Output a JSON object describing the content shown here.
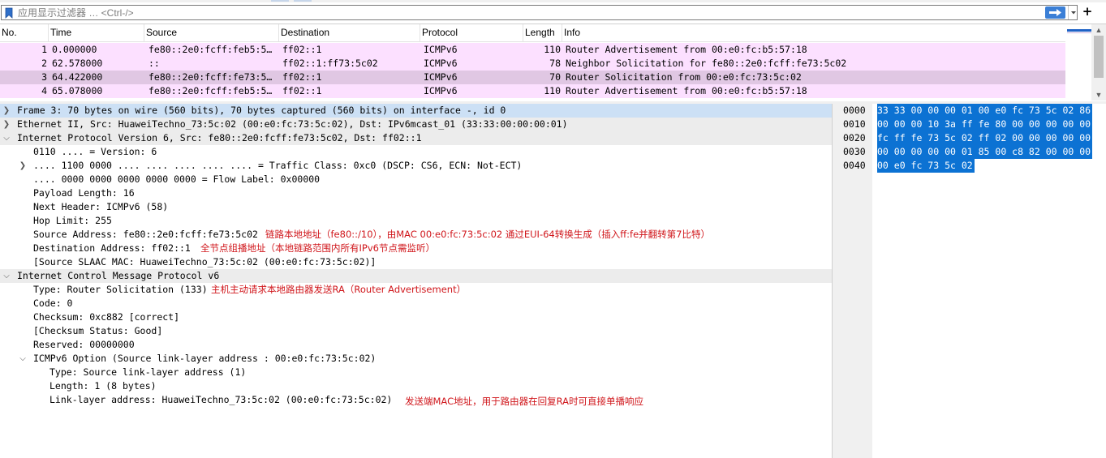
{
  "filter": {
    "placeholder": "应用显示过滤器 … <Ctrl-/>",
    "value": ""
  },
  "icons": {
    "bookmark": "bookmark-icon",
    "apply": "arrow-right-icon",
    "dropdown": "chevron-down-icon",
    "add": "plus-icon",
    "collapsed": "chevron-right-icon",
    "expanded": "chevron-down-icon"
  },
  "colors": {
    "icmp_row": "#fce0ff",
    "selected_row": "#e0c7e3",
    "annotation": "#d0161b",
    "byte_highlight": "#0c72d3"
  },
  "packet_list": {
    "columns": [
      "No.",
      "Time",
      "Source",
      "Destination",
      "Protocol",
      "Length",
      "Info"
    ],
    "rows": [
      {
        "no": "1",
        "time": "0.000000",
        "source": "fe80::2e0:fcff:feb5:5…",
        "destination": "ff02::1",
        "protocol": "ICMPv6",
        "length": "110",
        "info": "Router Advertisement from 00:e0:fc:b5:57:18",
        "selected": false
      },
      {
        "no": "2",
        "time": "62.578000",
        "source": "::",
        "destination": "ff02::1:ff73:5c02",
        "protocol": "ICMPv6",
        "length": "78",
        "info": "Neighbor Solicitation for fe80::2e0:fcff:fe73:5c02",
        "selected": false
      },
      {
        "no": "3",
        "time": "64.422000",
        "source": "fe80::2e0:fcff:fe73:5…",
        "destination": "ff02::1",
        "protocol": "ICMPv6",
        "length": "70",
        "info": "Router Solicitation from 00:e0:fc:73:5c:02",
        "selected": true
      },
      {
        "no": "4",
        "time": "65.078000",
        "source": "fe80::2e0:fcff:feb5:5…",
        "destination": "ff02::1",
        "protocol": "ICMPv6",
        "length": "110",
        "info": "Router Advertisement from 00:e0:fc:b5:57:18",
        "selected": false
      }
    ]
  },
  "details": {
    "frame": "Frame 3: 70 bytes on wire (560 bits), 70 bytes captured (560 bits) on interface -, id 0",
    "ethernet": "Ethernet II, Src: HuaweiTechno_73:5c:02 (00:e0:fc:73:5c:02), Dst: IPv6mcast_01 (33:33:00:00:00:01)",
    "ipv6": {
      "title": "Internet Protocol Version 6, Src: fe80::2e0:fcff:fe73:5c02, Dst: ff02::1",
      "version": "0110 .... = Version: 6",
      "traffic_class": ".... 1100 0000 .... .... .... .... .... = Traffic Class: 0xc0 (DSCP: CS6, ECN: Not-ECT)",
      "flow_label": ".... 0000 0000 0000 0000 0000 = Flow Label: 0x00000",
      "payload_length": "Payload Length: 16",
      "next_header": "Next Header: ICMPv6 (58)",
      "hop_limit": "Hop Limit: 255",
      "source": "Source Address: fe80::2e0:fcff:fe73:5c02",
      "source_note": "链路本地地址（fe80::/10），由MAC 00:e0:fc:73:5c:02 通过EUI-64转换生成（插入ff:fe并翻转第7比特）",
      "destination": "Destination Address: ff02::1",
      "destination_note": "全节点组播地址（本地链路范围内所有IPv6节点需监听）",
      "slaac": "[Source SLAAC MAC: HuaweiTechno_73:5c:02 (00:e0:fc:73:5c:02)]"
    },
    "icmpv6": {
      "title": "Internet Control Message Protocol v6",
      "type": "Type: Router Solicitation (133)",
      "type_note": "主机主动请求本地路由器发送RA（Router Advertisement）",
      "code": "Code: 0",
      "checksum": "Checksum: 0xc882 [correct]",
      "checksum_status": "[Checksum Status: Good]",
      "reserved": "Reserved: 00000000",
      "option_title": "ICMPv6 Option (Source link-layer address : 00:e0:fc:73:5c:02)",
      "option_type": "Type: Source link-layer address (1)",
      "option_length": "Length: 1 (8 bytes)",
      "option_lladdr": "Link-layer address: HuaweiTechno_73:5c:02 (00:e0:fc:73:5c:02)",
      "lladdr_note": "发送端MAC地址，用于路由器在回复RA时可直接单播响应"
    }
  },
  "bytes": {
    "rows": [
      {
        "offset": "0000",
        "hex": "33 33 00 00 00 01 00 e0  fc 73 5c 02 86"
      },
      {
        "offset": "0010",
        "hex": "00 00 00 10 3a ff fe 80  00 00 00 00 00"
      },
      {
        "offset": "0020",
        "hex": "fc ff fe 73 5c 02 ff 02  00 00 00 00 00"
      },
      {
        "offset": "0030",
        "hex": "00 00 00 00 00 01 85 00  c8 82 00 00 00"
      },
      {
        "offset": "0040",
        "hex": "00 e0 fc 73 5c 02"
      }
    ]
  }
}
